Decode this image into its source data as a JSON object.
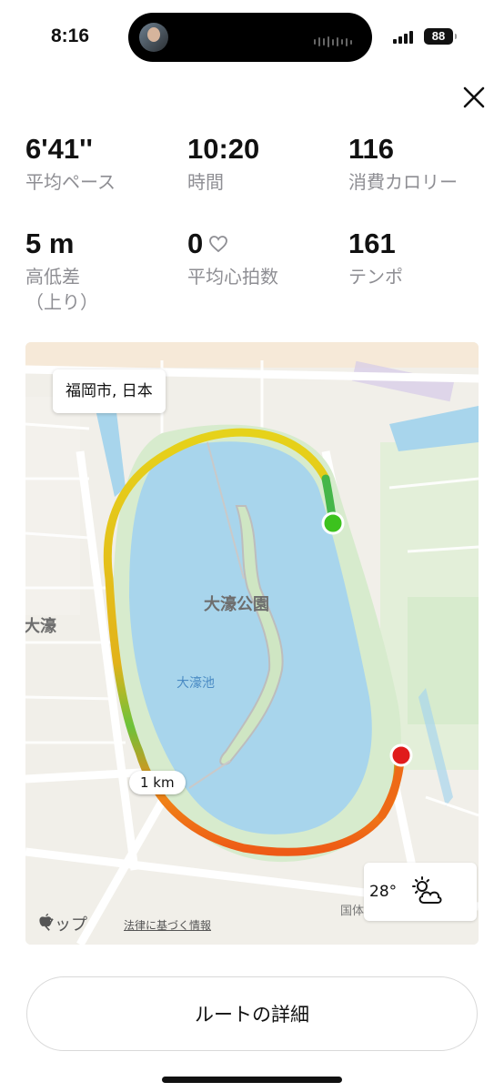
{
  "status_bar": {
    "time": "8:16",
    "battery": "88"
  },
  "stats": [
    {
      "value": "6'41''",
      "label": "平均ペース"
    },
    {
      "value": "10:20",
      "label": "時間"
    },
    {
      "value": "116",
      "label": "消費カロリー"
    },
    {
      "value": "5 m",
      "label": "高低差\n（上り）"
    },
    {
      "value": "0",
      "label": "平均心拍数"
    },
    {
      "value": "161",
      "label": "テンポ"
    }
  ],
  "map": {
    "location": "福岡市, 日本",
    "park_label": "大濠公園",
    "pond_label": "大濠池",
    "district_label": "大濠",
    "road_label": "国体",
    "distance_marker": "1 km",
    "temperature": "28°",
    "weather_icon": "partly-cloudy-icon",
    "maps_brand": "マップ",
    "legal_link": "法律に基づく情報",
    "route_colors": {
      "start": "#3cc21e",
      "end": "#e01b1b",
      "fast": "#45b649",
      "mid": "#e6d21a",
      "slow": "#ee6a16",
      "water": "#a8d5ec"
    }
  },
  "route_button": "ルートの詳細"
}
